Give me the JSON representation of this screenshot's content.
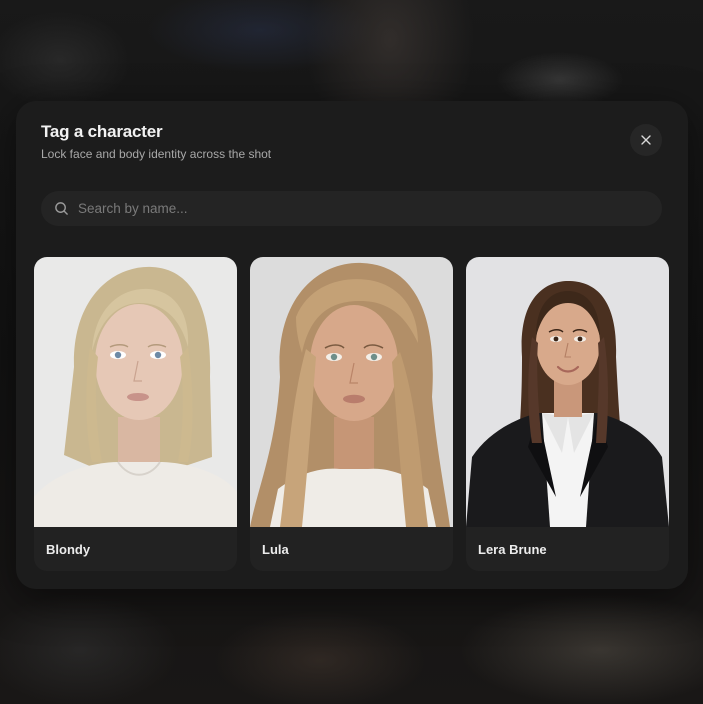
{
  "dialog": {
    "title": "Tag a character",
    "subtitle": "Lock face and body identity across the shot",
    "close_icon": "close-icon"
  },
  "search": {
    "placeholder": "Search by name...",
    "value": "",
    "icon": "search-icon"
  },
  "characters": [
    {
      "name": "Blondy"
    },
    {
      "name": "Lula"
    },
    {
      "name": "Lera Brune"
    }
  ],
  "colors": {
    "dialog_bg": "#1c1c1c",
    "card_bg": "#222222",
    "search_bg": "#242424",
    "title": "#f2f2f2",
    "subtitle": "#a8a8a8"
  }
}
